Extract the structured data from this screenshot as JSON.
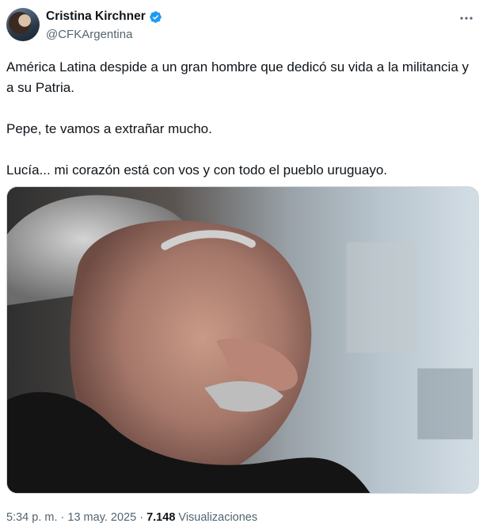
{
  "author": {
    "display_name": "Cristina Kirchner",
    "handle": "@CFKArgentina",
    "verified_color": "#1d9bf0"
  },
  "tweet": {
    "lines": [
      "América Latina despide a un gran hombre que dedicó su vida a la militancia y a su Patria.",
      "Pepe, te vamos a extrañar mucho.",
      "Lucía... mi corazón está con vos y con todo el pueblo uruguayo."
    ]
  },
  "meta": {
    "time": "5:34 p. m.",
    "separator": "·",
    "date": "13 may. 2025",
    "views_count": "7.148",
    "views_label": "Visualizaciones"
  },
  "icons": {
    "more": "more-dots-icon",
    "verified": "verified-badge-icon"
  }
}
